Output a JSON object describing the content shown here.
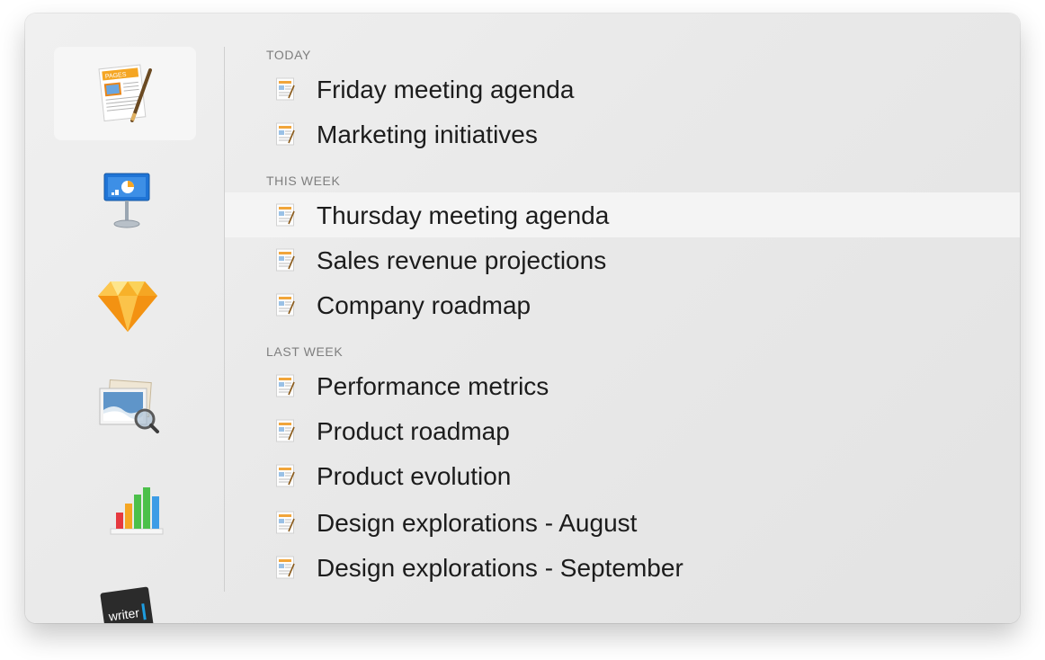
{
  "sidebar": {
    "apps": [
      {
        "name": "pages-app-icon",
        "label": "PAGES"
      },
      {
        "name": "keynote-app-icon"
      },
      {
        "name": "sketch-app-icon"
      },
      {
        "name": "preview-app-icon"
      },
      {
        "name": "numbers-app-icon"
      },
      {
        "name": "ia-writer-app-icon",
        "label": "writer"
      }
    ]
  },
  "sections": [
    {
      "title": "TODAY",
      "items": [
        "Friday meeting agenda",
        "Marketing initiatives"
      ]
    },
    {
      "title": "THIS WEEK",
      "items": [
        "Thursday meeting agenda",
        "Sales revenue projections",
        "Company roadmap"
      ]
    },
    {
      "title": "LAST WEEK",
      "items": [
        "Performance metrics",
        "Product roadmap",
        "Product evolution",
        "Design explorations - August",
        "Design explorations - September"
      ]
    }
  ],
  "colors": {
    "accent_orange": "#f5a623",
    "highlight": "#f4f4f4"
  }
}
